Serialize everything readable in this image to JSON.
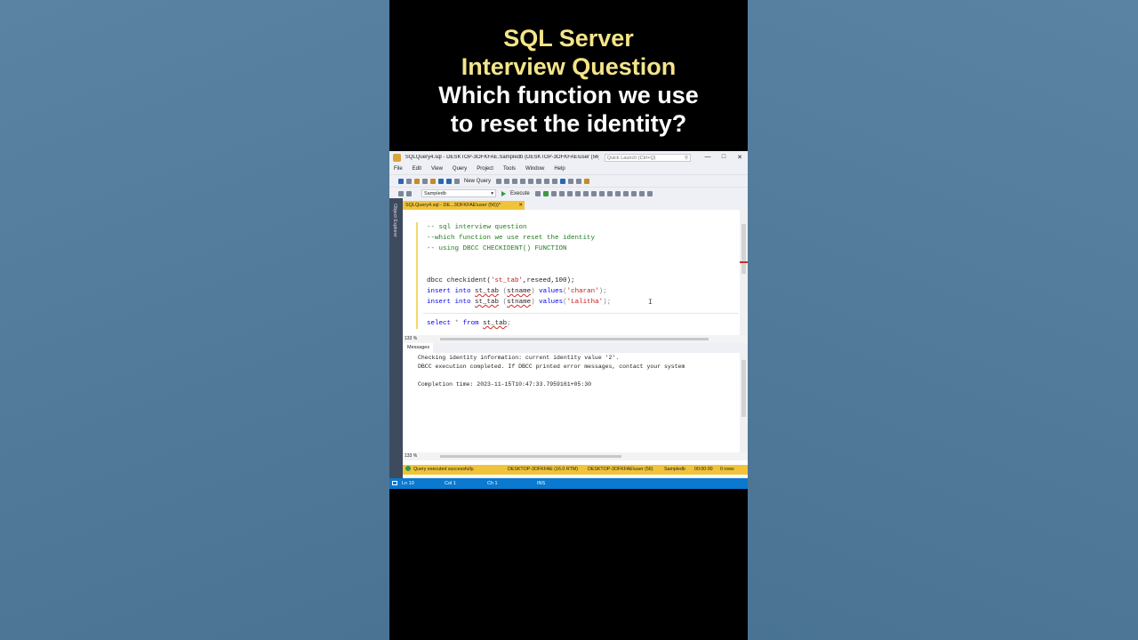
{
  "caption": {
    "line1": "SQL Server",
    "line2": "Interview Question",
    "line3": "Which function we use",
    "line4": "to reset the identity?"
  },
  "window": {
    "title": "SQLQuery4.sql - DESKTOP-3OFKFAE.Sampledb (DESKTOP-3OFKFAE\\user (56))*...",
    "quick_launch_placeholder": "Quick Launch (Ctrl+Q)"
  },
  "menu": [
    "File",
    "Edit",
    "View",
    "Query",
    "Project",
    "Tools",
    "Window",
    "Help"
  ],
  "toolbar": {
    "new_query": "New Query",
    "database": "Sampledb",
    "execute": "Execute"
  },
  "sidebar": {
    "object_explorer": "Object Explorer"
  },
  "tab": {
    "label": "SQLQuery4.sql - DE...3OFKFAE\\user (56))*"
  },
  "editor": {
    "comments": [
      "-- sql interview question",
      "--which function we use reset the identity",
      "-- using DBCC CHECKIDENT() FUNCTION"
    ],
    "line_dbcc": {
      "fn": "dbcc checkident(",
      "arg": "'st_tab'",
      "rest": ",reseed,100);"
    },
    "insert1_value": "'charan'",
    "insert2_value": "'Lalitha'",
    "kw_insert": "insert into",
    "kw_values": "values",
    "tbl": "st_tab",
    "col": "stname",
    "kw_select": "select",
    "kw_from": "from"
  },
  "zoom": "133 %",
  "results_tab": "Messages",
  "messages": [
    "Checking identity information: current identity value '2'.",
    "DBCC execution completed. If DBCC printed error messages, contact your system",
    "",
    "Completion time: 2023-11-15T10:47:33.7959161+05:30"
  ],
  "query_status": {
    "text": "Query executed successfully.",
    "server": "DESKTOP-3OFKFAE (16.0 RTM)",
    "user": "DESKTOP-3OFKFAE\\user (56)",
    "db": "Sampledb",
    "time": "00:00:00",
    "rows": "0 rows"
  },
  "app_status": {
    "ln": "Ln 10",
    "col": "Col 1",
    "ch": "Ch 1",
    "mode": "INS"
  }
}
